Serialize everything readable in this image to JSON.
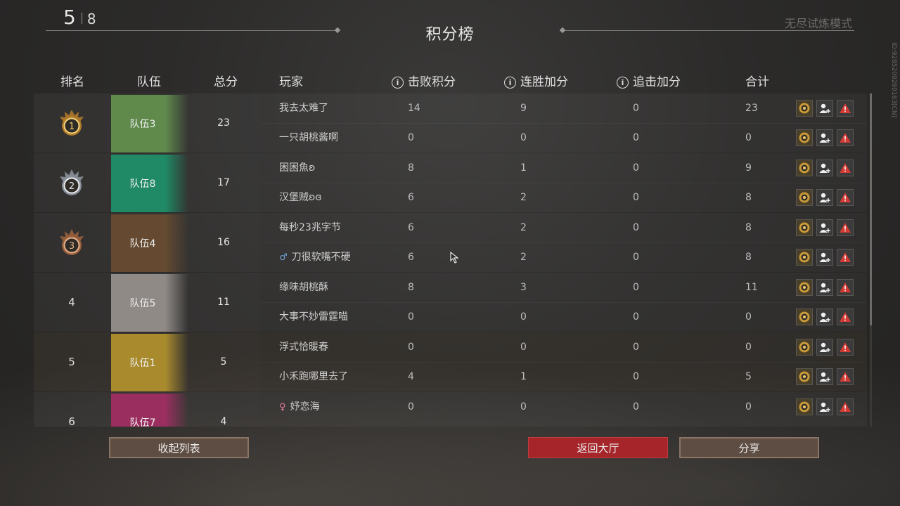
{
  "header": {
    "round_current": "5",
    "round_total": "8",
    "title": "积分榜",
    "mode": "无尽试炼模式",
    "side_id": "ID:9285200280163[CN]"
  },
  "columns": {
    "rank": "排名",
    "team": "队伍",
    "total": "总分",
    "player": "玩家",
    "defeat": "击败积分",
    "streak": "连胜加分",
    "chase": "追击加分",
    "sum": "合计"
  },
  "teams": [
    {
      "rank": "1",
      "rank_style": "gold",
      "team": "队伍3",
      "team_color": "#5f8a4c",
      "total": "23",
      "highlight": false,
      "players": [
        {
          "name": "我去太难了",
          "gender": "",
          "defeat": "14",
          "streak": "9",
          "chase": "0",
          "sum": "23"
        },
        {
          "name": "一只胡桃酱啊",
          "gender": "",
          "defeat": "0",
          "streak": "0",
          "chase": "0",
          "sum": "0"
        }
      ]
    },
    {
      "rank": "2",
      "rank_style": "silver",
      "team": "队伍8",
      "team_color": "#1f8a65",
      "total": "17",
      "highlight": false,
      "players": [
        {
          "name": "困困魚ʚ",
          "gender": "",
          "defeat": "8",
          "streak": "1",
          "chase": "0",
          "sum": "9"
        },
        {
          "name": "汉堡贼ʚɞ",
          "gender": "",
          "defeat": "6",
          "streak": "2",
          "chase": "0",
          "sum": "8"
        }
      ]
    },
    {
      "rank": "3",
      "rank_style": "bronze",
      "team": "队伍4",
      "team_color": "#654a31",
      "total": "16",
      "highlight": false,
      "players": [
        {
          "name": "每秒23兆字节",
          "gender": "",
          "defeat": "6",
          "streak": "2",
          "chase": "0",
          "sum": "8"
        },
        {
          "name": "刀很软嘴不硬",
          "gender": "♂",
          "defeat": "6",
          "streak": "2",
          "chase": "0",
          "sum": "8"
        }
      ]
    },
    {
      "rank": "4",
      "rank_style": "plain",
      "team": "队伍5",
      "team_color": "#8f8a86",
      "total": "11",
      "highlight": false,
      "players": [
        {
          "name": "缘味胡桃酥",
          "gender": "",
          "defeat": "8",
          "streak": "3",
          "chase": "0",
          "sum": "11"
        },
        {
          "name": "大事不妙雷霆喵",
          "gender": "",
          "defeat": "0",
          "streak": "0",
          "chase": "0",
          "sum": "0"
        }
      ]
    },
    {
      "rank": "5",
      "rank_style": "plain",
      "team": "队伍1",
      "team_color": "#a98b2e",
      "total": "5",
      "highlight": true,
      "players": [
        {
          "name": "浮式恰暖春",
          "gender": "",
          "defeat": "0",
          "streak": "0",
          "chase": "0",
          "sum": "0"
        },
        {
          "name": "小禾跑哪里去了",
          "gender": "",
          "defeat": "4",
          "streak": "1",
          "chase": "0",
          "sum": "5"
        }
      ]
    },
    {
      "rank": "6",
      "rank_style": "plain",
      "team": "队伍7",
      "team_color": "#9a2f5f",
      "total": "4",
      "highlight": false,
      "players": [
        {
          "name": "妤恋海",
          "gender": "♀",
          "defeat": "0",
          "streak": "0",
          "chase": "0",
          "sum": "0"
        }
      ]
    }
  ],
  "buttons": {
    "collapse": "收起列表",
    "back": "返回大厅",
    "share": "分享"
  },
  "icons": {
    "row_actions": [
      "profile-badge-icon",
      "add-friend-icon",
      "report-icon"
    ],
    "column_info": "info-icon"
  }
}
